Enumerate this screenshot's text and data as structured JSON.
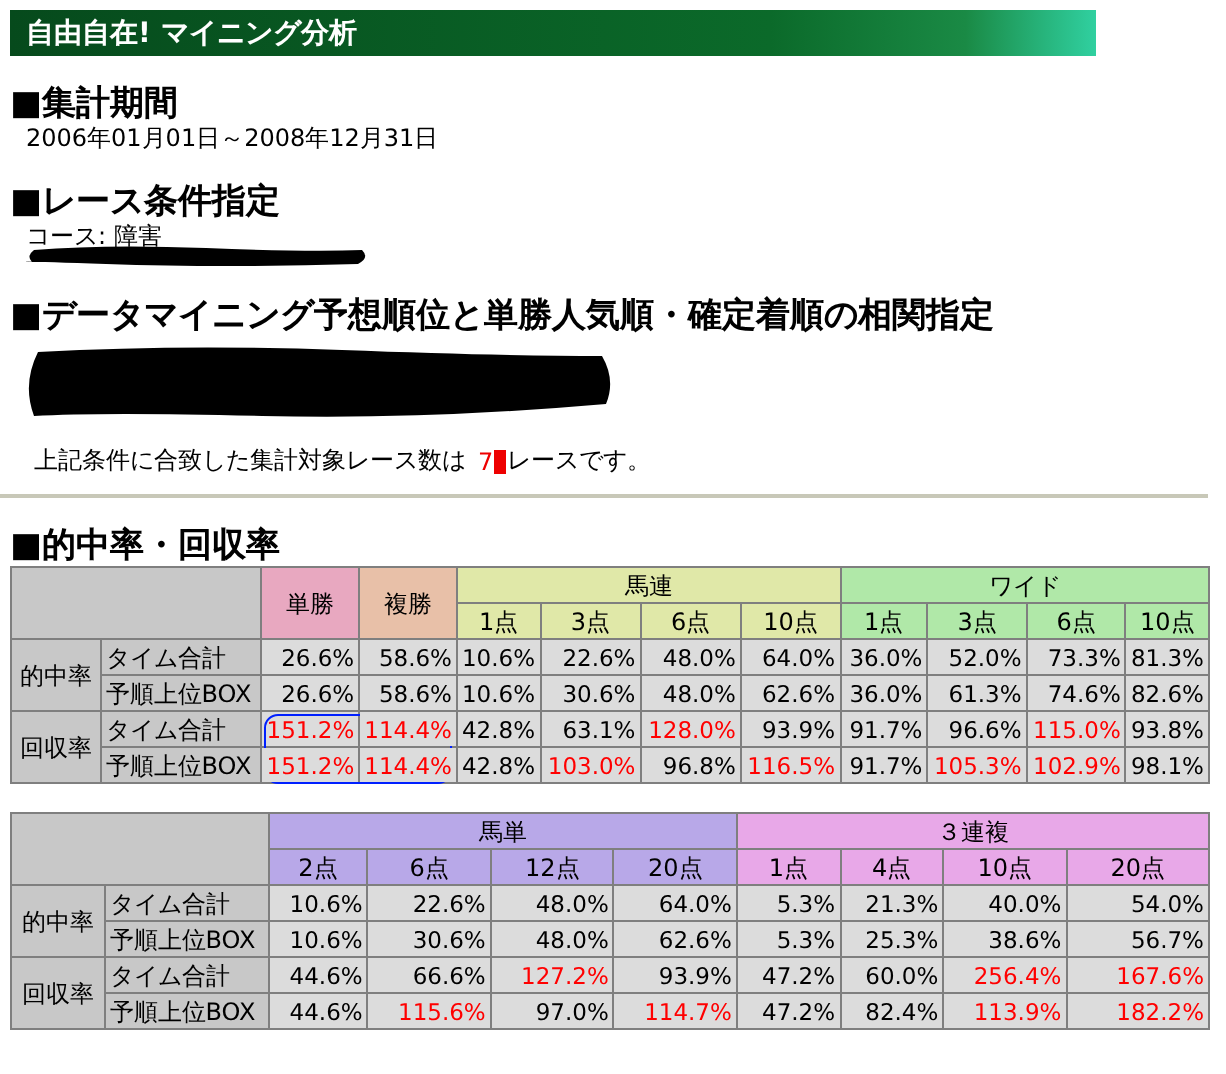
{
  "title_bar": {
    "title": "自由自在! マイニング分析"
  },
  "period": {
    "heading": "■集計期間",
    "value": "2006年01月01日～2008年12月31日"
  },
  "race_conditions": {
    "heading": "■レース条件指定",
    "course": "コース: 障害"
  },
  "correlation": {
    "heading": "■データマイニング予想順位と単勝人気順・確定着順の相関指定"
  },
  "summary": {
    "before": "上記条件に合致した集計対象レース数は",
    "count": "7",
    "after": "レースです。"
  },
  "results": {
    "heading": "■的中率・回収率",
    "tables": [
      {
        "groups": [
          {
            "label": "単勝",
            "color": "#e8a8c0"
          },
          {
            "label": "複勝",
            "color": "#e8c0a8"
          },
          {
            "label": "馬連",
            "color": "#e0e8a8",
            "columns": [
              "1点",
              "3点",
              "6点",
              "10点"
            ]
          },
          {
            "label": "ワイド",
            "color": "#b0e8a8",
            "columns": [
              "1点",
              "3点",
              "6点",
              "10点"
            ]
          }
        ],
        "row_groups": [
          {
            "label": "的中率",
            "rows": [
              {
                "label": "タイム合計",
                "cells": [
                  {
                    "value": "26.6%",
                    "highlighted": false
                  },
                  {
                    "value": "58.6%",
                    "highlighted": false
                  },
                  {
                    "value": "10.6%",
                    "highlighted": false
                  },
                  {
                    "value": "22.6%",
                    "highlighted": false
                  },
                  {
                    "value": "48.0%",
                    "highlighted": false
                  },
                  {
                    "value": "64.0%",
                    "highlighted": false
                  },
                  {
                    "value": "36.0%",
                    "highlighted": false
                  },
                  {
                    "value": "52.0%",
                    "highlighted": false
                  },
                  {
                    "value": "73.3%",
                    "highlighted": false
                  },
                  {
                    "value": "81.3%",
                    "highlighted": false
                  }
                ]
              },
              {
                "label": "予順上位BOX",
                "cells": [
                  {
                    "value": "26.6%",
                    "highlighted": false
                  },
                  {
                    "value": "58.6%",
                    "highlighted": false
                  },
                  {
                    "value": "10.6%",
                    "highlighted": false
                  },
                  {
                    "value": "30.6%",
                    "highlighted": false
                  },
                  {
                    "value": "48.0%",
                    "highlighted": false
                  },
                  {
                    "value": "62.6%",
                    "highlighted": false
                  },
                  {
                    "value": "36.0%",
                    "highlighted": false
                  },
                  {
                    "value": "61.3%",
                    "highlighted": false
                  },
                  {
                    "value": "74.6%",
                    "highlighted": false
                  },
                  {
                    "value": "82.6%",
                    "highlighted": false
                  }
                ]
              }
            ]
          },
          {
            "label": "回収率",
            "rows": [
              {
                "label": "タイム合計",
                "cells": [
                  {
                    "value": "151.2%",
                    "highlighted": true,
                    "circled": true
                  },
                  {
                    "value": "114.4%",
                    "highlighted": true
                  },
                  {
                    "value": "42.8%",
                    "highlighted": false
                  },
                  {
                    "value": "63.1%",
                    "highlighted": false
                  },
                  {
                    "value": "128.0%",
                    "highlighted": true
                  },
                  {
                    "value": "93.9%",
                    "highlighted": false
                  },
                  {
                    "value": "91.7%",
                    "highlighted": false
                  },
                  {
                    "value": "96.6%",
                    "highlighted": false
                  },
                  {
                    "value": "115.0%",
                    "highlighted": true
                  },
                  {
                    "value": "93.8%",
                    "highlighted": false
                  }
                ]
              },
              {
                "label": "予順上位BOX",
                "cells": [
                  {
                    "value": "151.2%",
                    "highlighted": true
                  },
                  {
                    "value": "114.4%",
                    "highlighted": true
                  },
                  {
                    "value": "42.8%",
                    "highlighted": false
                  },
                  {
                    "value": "103.0%",
                    "highlighted": true
                  },
                  {
                    "value": "96.8%",
                    "highlighted": false
                  },
                  {
                    "value": "116.5%",
                    "highlighted": true
                  },
                  {
                    "value": "91.7%",
                    "highlighted": false
                  },
                  {
                    "value": "105.3%",
                    "highlighted": true
                  },
                  {
                    "value": "102.9%",
                    "highlighted": true
                  },
                  {
                    "value": "98.1%",
                    "highlighted": false
                  }
                ]
              }
            ]
          }
        ]
      },
      {
        "groups": [
          {
            "label": "馬単",
            "color": "#b8a8e8",
            "columns": [
              "2点",
              "6点",
              "12点",
              "20点"
            ]
          },
          {
            "label": "３連複",
            "color": "#e8a8e8",
            "columns": [
              "1点",
              "4点",
              "10点",
              "20点"
            ]
          }
        ],
        "row_groups": [
          {
            "label": "的中率",
            "rows": [
              {
                "label": "タイム合計",
                "cells": [
                  {
                    "value": "10.6%",
                    "highlighted": false
                  },
                  {
                    "value": "22.6%",
                    "highlighted": false
                  },
                  {
                    "value": "48.0%",
                    "highlighted": false
                  },
                  {
                    "value": "64.0%",
                    "highlighted": false
                  },
                  {
                    "value": "5.3%",
                    "highlighted": false
                  },
                  {
                    "value": "21.3%",
                    "highlighted": false
                  },
                  {
                    "value": "40.0%",
                    "highlighted": false
                  },
                  {
                    "value": "54.0%",
                    "highlighted": false
                  }
                ]
              },
              {
                "label": "予順上位BOX",
                "cells": [
                  {
                    "value": "10.6%",
                    "highlighted": false
                  },
                  {
                    "value": "30.6%",
                    "highlighted": false
                  },
                  {
                    "value": "48.0%",
                    "highlighted": false
                  },
                  {
                    "value": "62.6%",
                    "highlighted": false
                  },
                  {
                    "value": "5.3%",
                    "highlighted": false
                  },
                  {
                    "value": "25.3%",
                    "highlighted": false
                  },
                  {
                    "value": "38.6%",
                    "highlighted": false
                  },
                  {
                    "value": "56.7%",
                    "highlighted": false
                  }
                ]
              }
            ]
          },
          {
            "label": "回収率",
            "rows": [
              {
                "label": "タイム合計",
                "cells": [
                  {
                    "value": "44.6%",
                    "highlighted": false
                  },
                  {
                    "value": "66.6%",
                    "highlighted": false
                  },
                  {
                    "value": "127.2%",
                    "highlighted": true
                  },
                  {
                    "value": "93.9%",
                    "highlighted": false
                  },
                  {
                    "value": "47.2%",
                    "highlighted": false
                  },
                  {
                    "value": "60.0%",
                    "highlighted": false
                  },
                  {
                    "value": "256.4%",
                    "highlighted": true
                  },
                  {
                    "value": "167.6%",
                    "highlighted": true
                  }
                ]
              },
              {
                "label": "予順上位BOX",
                "cells": [
                  {
                    "value": "44.6%",
                    "highlighted": false
                  },
                  {
                    "value": "115.6%",
                    "highlighted": true
                  },
                  {
                    "value": "97.0%",
                    "highlighted": false
                  },
                  {
                    "value": "114.7%",
                    "highlighted": true
                  },
                  {
                    "value": "47.2%",
                    "highlighted": false
                  },
                  {
                    "value": "82.4%",
                    "highlighted": false
                  },
                  {
                    "value": "113.9%",
                    "highlighted": true
                  },
                  {
                    "value": "182.2%",
                    "highlighted": true
                  }
                ]
              }
            ]
          }
        ]
      }
    ]
  }
}
